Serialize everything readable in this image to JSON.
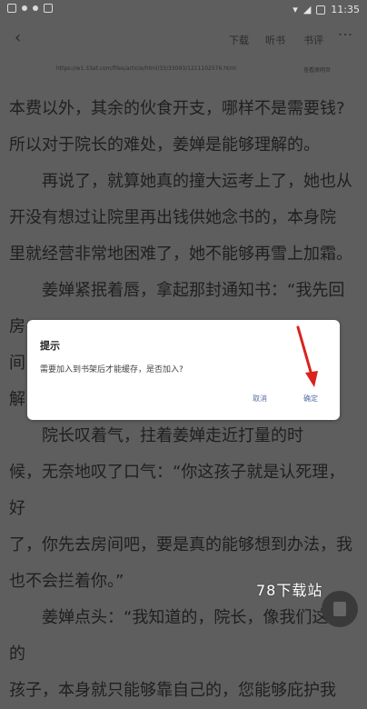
{
  "status_bar": {
    "time": "11:35"
  },
  "toolbar": {
    "download": "下载",
    "listen": "听书",
    "review": "书评",
    "more": "⋮"
  },
  "url_bar": {
    "url": "https://w1.33at.com/files/article/html/33/33093/1211102576.html",
    "original": "查看原网页"
  },
  "content": {
    "lines": [
      "本费以外，其余的伙食开支，哪样不是需要钱?",
      "所以对于院长的难处，姜婵是能够理解的。",
      "再说了，就算她真的撞大运考上了，她也从",
      "开没有想过让院里再出钱供她念书的，本身院",
      "里就经营非常地困难了，她不能够再雪上加霜。",
      "姜婵紧抿着唇，拿起那封通知书：“我先回房",
      "间",
      "解",
      "院长叹着气，拄着姜婵走近打量的时",
      "候，无奈地叹了口气：“你这孩子就是认死理，好",
      "了，你先去房间吧，要是真的能够想到办法，我",
      "也不会拦着你。”",
      "姜婵点头：“我知道的，院长，像我们这样的",
      "孩子，本身就只能够靠自己的，您能够庇护我"
    ]
  },
  "dialog": {
    "title": "提示",
    "message": "需要加入到书架后才能缓存，是否加入?",
    "cancel": "取消",
    "confirm": "确定"
  },
  "watermark": "78下载站",
  "colors": {
    "overlay_bg": "#5e5e5e",
    "dialog_button": "#5b6ea8",
    "annotation_arrow": "#d9231c"
  }
}
